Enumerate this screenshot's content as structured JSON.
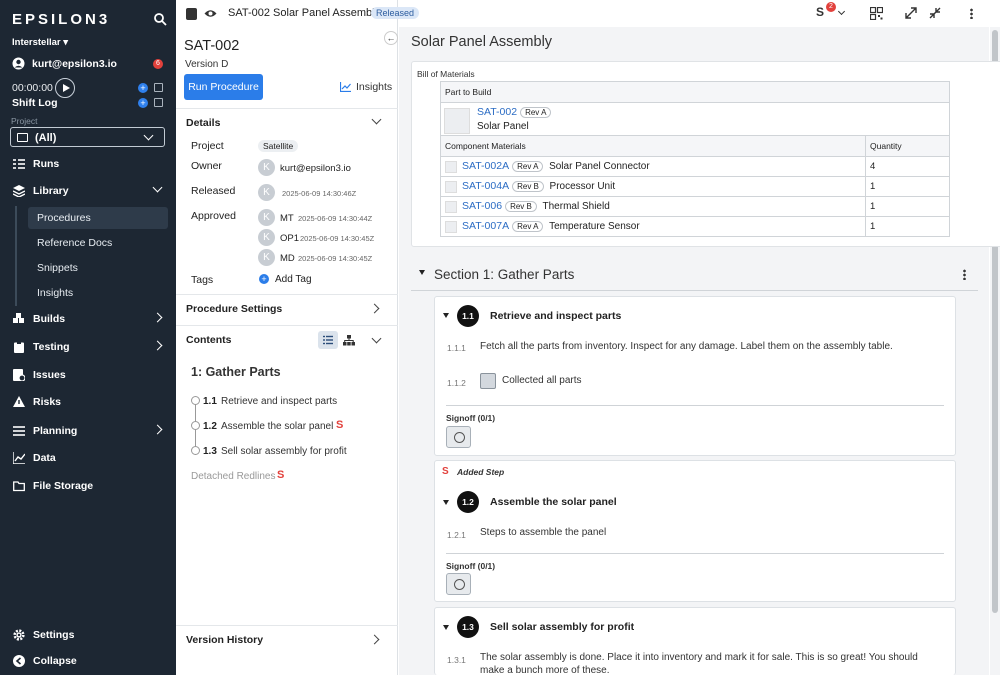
{
  "nav": {
    "logo": "EPSILON3",
    "org": "Interstellar ▾",
    "user": "kurt@epsilon3.io",
    "user_badge": "6",
    "timer": "00:00:00",
    "shift_log": "Shift Log",
    "project_label": "Project",
    "project_value": "(All)",
    "items": {
      "runs": "Runs",
      "library": "Library",
      "builds": "Builds",
      "testing": "Testing",
      "issues": "Issues",
      "risks": "Risks",
      "planning": "Planning",
      "data": "Data",
      "file_storage": "File Storage",
      "settings": "Settings",
      "collapse": "Collapse"
    },
    "library_sub": {
      "procedures": "Procedures",
      "reference_docs": "Reference Docs",
      "snippets": "Snippets",
      "insights": "Insights"
    }
  },
  "topbar": {
    "doc_title": "SAT-002 Solar Panel Assembly",
    "status": "Released",
    "notif_count": "2"
  },
  "details_panel": {
    "title": "SAT-002",
    "version": "Version D",
    "run_button": "Run Procedure",
    "insights": "Insights",
    "details_header": "Details",
    "project_key": "Project",
    "project_val": "Satellite",
    "owner_key": "Owner",
    "owner_val": "kurt@epsilon3.io",
    "released_key": "Released",
    "released_ts": "2025-06-09 14:30:46Z",
    "approved_key": "Approved",
    "approvers": [
      {
        "initials": "MT",
        "ts": "2025-06-09 14:30:44Z"
      },
      {
        "initials": "OP1",
        "ts": "2025-06-09 14:30:45Z"
      },
      {
        "initials": "MD",
        "ts": "2025-06-09 14:30:45Z"
      }
    ],
    "tags_key": "Tags",
    "add_tag": "Add Tag",
    "procedure_settings": "Procedure Settings",
    "contents_header": "Contents",
    "toc_section": "1: Gather Parts",
    "toc_items": [
      {
        "num": "1.1",
        "label": "Retrieve and inspect parts"
      },
      {
        "num": "1.2",
        "label": "Assemble the solar panel"
      },
      {
        "num": "1.3",
        "label": "Sell solar assembly for profit"
      }
    ],
    "detached_redlines": "Detached Redlines",
    "version_history": "Version History"
  },
  "main": {
    "title": "Solar Panel Assembly",
    "bom_label": "Bill of Materials",
    "part_to_build_header": "Part to Build",
    "part_to_build": {
      "id": "SAT-002",
      "rev": "Rev A",
      "name": "Solar Panel"
    },
    "component_header": "Component Materials",
    "quantity_header": "Quantity",
    "components": [
      {
        "id": "SAT-002A",
        "rev": "Rev A",
        "name": "Solar Panel Connector",
        "qty": "4"
      },
      {
        "id": "SAT-004A",
        "rev": "Rev B",
        "name": "Processor Unit",
        "qty": "1"
      },
      {
        "id": "SAT-006",
        "rev": "Rev B",
        "name": "Thermal Shield",
        "qty": "1"
      },
      {
        "id": "SAT-007A",
        "rev": "Rev A",
        "name": "Temperature Sensor",
        "qty": "1"
      }
    ],
    "section_title": "Section 1: Gather Parts",
    "added_step": "Added Step",
    "steps": [
      {
        "num": "1.1",
        "title": "Retrieve and inspect parts",
        "sub1_num": "1.1.1",
        "sub1_text": "Fetch all the parts from inventory.  Inspect for any damage.  Label them on the assembly table.",
        "sub2_num": "1.1.2",
        "sub2_text": "Collected all parts",
        "signoff": "Signoff (0/1)"
      },
      {
        "num": "1.2",
        "title": "Assemble the solar panel",
        "sub1_num": "1.2.1",
        "sub1_text": "Steps to assemble the panel",
        "signoff": "Signoff (0/1)"
      },
      {
        "num": "1.3",
        "title": "Sell solar assembly for profit",
        "sub1_num": "1.3.1",
        "sub1_text": "The solar assembly is done.  Place it into inventory and mark it for sale.  This is so great!  You should",
        "sub1_text2": "make a bunch more of these."
      }
    ]
  }
}
